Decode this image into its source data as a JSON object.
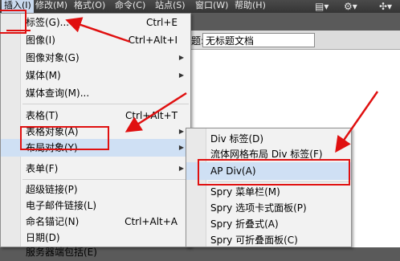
{
  "menubar": {
    "items": [
      {
        "label": "插入(I)",
        "active": true
      },
      {
        "label": "修改(M)",
        "active": false
      },
      {
        "label": "格式(O)",
        "active": false
      },
      {
        "label": "命令(C)",
        "active": false
      },
      {
        "label": "站点(S)",
        "active": false
      },
      {
        "label": "窗口(W)",
        "active": false
      },
      {
        "label": "帮助(H)",
        "active": false
      }
    ]
  },
  "document": {
    "title_label": "题:",
    "title_value": "无标题文档"
  },
  "insert_menu": {
    "items": [
      {
        "label": "标签(G)...",
        "shortcut": "Ctrl+E",
        "submenu": false
      },
      {
        "label": "图像(I)",
        "shortcut": "Ctrl+Alt+I",
        "submenu": false
      },
      {
        "label": "图像对象(G)",
        "shortcut": "",
        "submenu": true
      },
      {
        "label": "媒体(M)",
        "shortcut": "",
        "submenu": true
      },
      {
        "label": "媒体查询(M)...",
        "shortcut": "",
        "submenu": false
      },
      {
        "label": "表格(T)",
        "shortcut": "Ctrl+Alt+T",
        "submenu": false
      },
      {
        "label": "表格对象(A)",
        "shortcut": "",
        "submenu": true
      },
      {
        "label": "布局对象(Y)",
        "shortcut": "",
        "submenu": true,
        "highlighted": true
      },
      {
        "label": "表单(F)",
        "shortcut": "",
        "submenu": true
      },
      {
        "label": "超级链接(P)",
        "shortcut": "",
        "submenu": false
      },
      {
        "label": "电子邮件链接(L)",
        "shortcut": "",
        "submenu": false
      },
      {
        "label": "命名锚记(N)",
        "shortcut": "Ctrl+Alt+A",
        "submenu": false
      },
      {
        "label": "日期(D)",
        "shortcut": "",
        "submenu": false
      },
      {
        "label": "服务器端包括(E)",
        "shortcut": "",
        "submenu": false
      }
    ]
  },
  "layout_submenu": {
    "items": [
      {
        "label": "Div 标签(D)"
      },
      {
        "label": "流体网格布局 Div 标签(F)"
      },
      {
        "label": "AP Div(A)",
        "highlighted": true
      },
      {
        "label": "Spry 菜单栏(M)"
      },
      {
        "label": "Spry 选项卡式面板(P)"
      },
      {
        "label": "Spry 折叠式(A)"
      },
      {
        "label": "Spry 可折叠面板(C)"
      }
    ]
  },
  "colors": {
    "annotation": "#e01010",
    "highlight": "#cfe0f4",
    "menubar": "#3e3e3e"
  }
}
